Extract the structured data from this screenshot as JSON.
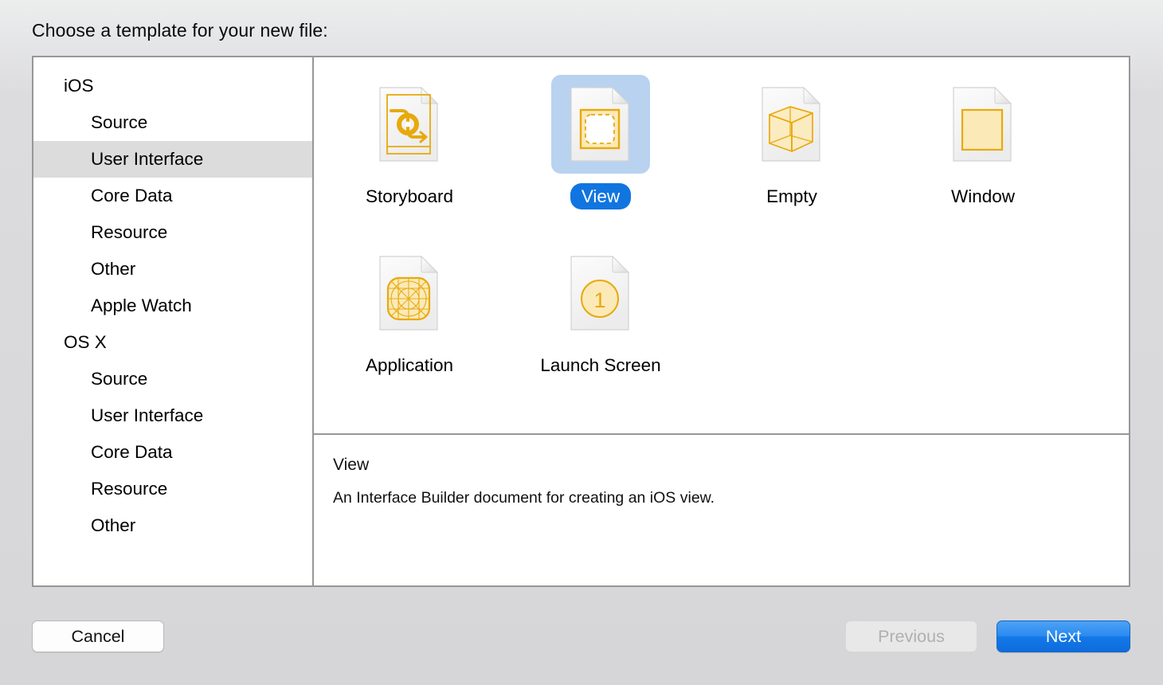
{
  "dialog": {
    "prompt": "Choose a template for your new file:"
  },
  "sidebar": {
    "groups": [
      {
        "label": "iOS",
        "items": [
          {
            "label": "Source",
            "selected": false
          },
          {
            "label": "User Interface",
            "selected": true
          },
          {
            "label": "Core Data",
            "selected": false
          },
          {
            "label": "Resource",
            "selected": false
          },
          {
            "label": "Other",
            "selected": false
          },
          {
            "label": "Apple Watch",
            "selected": false
          }
        ]
      },
      {
        "label": "OS X",
        "items": [
          {
            "label": "Source",
            "selected": false
          },
          {
            "label": "User Interface",
            "selected": false
          },
          {
            "label": "Core Data",
            "selected": false
          },
          {
            "label": "Resource",
            "selected": false
          },
          {
            "label": "Other",
            "selected": false
          }
        ]
      }
    ]
  },
  "templates": {
    "row1": [
      {
        "label": "Storyboard",
        "icon": "storyboard-icon",
        "selected": false
      },
      {
        "label": "View",
        "icon": "view-icon",
        "selected": true
      },
      {
        "label": "Empty",
        "icon": "empty-cube-icon",
        "selected": false
      },
      {
        "label": "Window",
        "icon": "window-icon",
        "selected": false
      }
    ],
    "row2": [
      {
        "label": "Application",
        "icon": "application-grid-icon",
        "selected": false
      },
      {
        "label": "Launch Screen",
        "icon": "launch-screen-icon",
        "selected": false
      }
    ]
  },
  "description": {
    "title": "View",
    "body": "An Interface Builder document for creating an iOS view."
  },
  "footer": {
    "cancel_label": "Cancel",
    "previous_label": "Previous",
    "next_label": "Next"
  },
  "colors": {
    "selection_fill": "#b8d2f0",
    "selection_pill": "#1175e0",
    "sidebar_selection": "#dcdcdc",
    "icon_orange": "#e8a90c",
    "icon_fill": "#fbeab8",
    "next_button": "#1278e8",
    "window_bg": "#d6d6d8"
  }
}
